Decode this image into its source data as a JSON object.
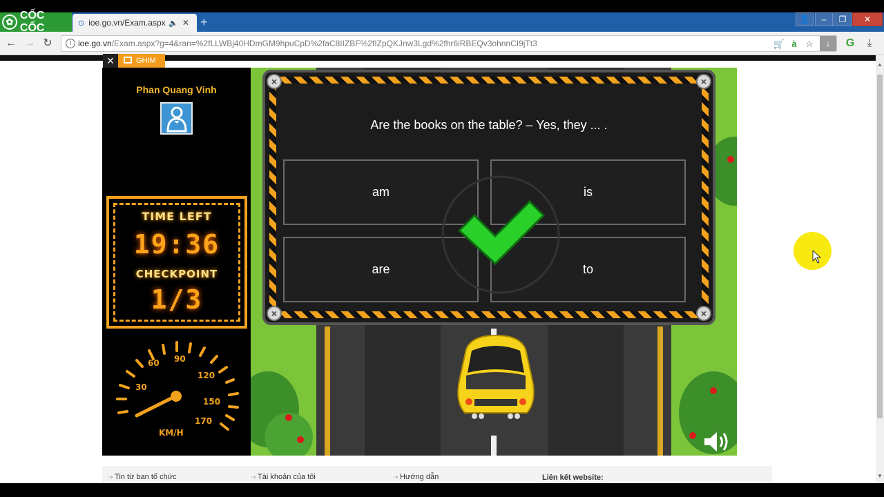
{
  "browser": {
    "brand": "CỐC CỐC",
    "tab_title": "ioe.go.vn/Exam.aspx?g",
    "url_host": "ioe.go.vn",
    "url_rest": "/Exam.aspx?g=4&ran=%2fLLWBj40HDmGM9hpuCpD%2faC8IIZBF%2fIZpQKJnw3Lgd%2fhr6iRBEQv3ohnnCI9jTt3"
  },
  "page": {
    "ghim_label": "GHIM"
  },
  "player": {
    "name": "Phan Quang Vinh"
  },
  "hud": {
    "time_label": "TIME LEFT",
    "time_value": "19:36",
    "checkpoint_label": "CHECKPOINT",
    "checkpoint_value": "1/3",
    "speed_unit": "KM/H",
    "speed_ticks": [
      "30",
      "60",
      "90",
      "120",
      "150",
      "170"
    ]
  },
  "quiz": {
    "question": "Are the books on the table? – Yes, they ... .",
    "answers": [
      "am",
      "is",
      "are",
      "to"
    ],
    "result": "correct"
  },
  "footer": {
    "links": [
      "Tin từ ban tổ chức",
      "Tài khoản của tôi",
      "Hướng dẫn"
    ],
    "heading": "Liên kết website:"
  },
  "colors": {
    "accent": "#f3a21e",
    "brand_green": "#2c9b35",
    "check_green": "#2bd12b"
  }
}
